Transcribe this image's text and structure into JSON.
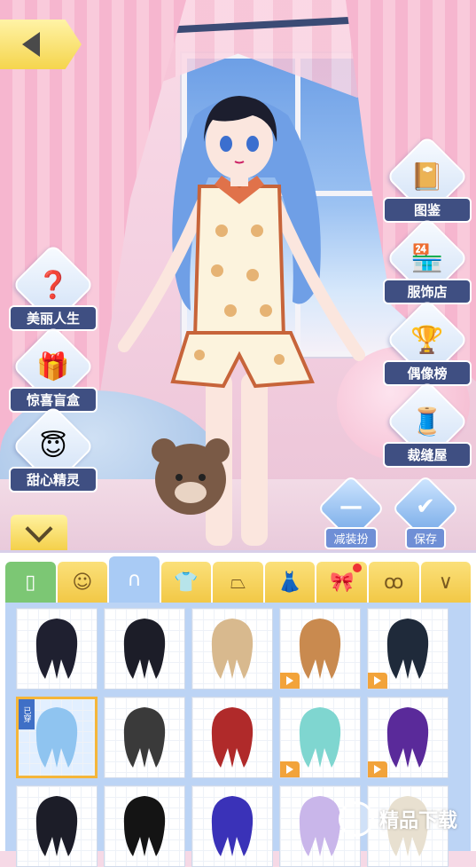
{
  "menu": {
    "encyclopedia_label": "图鉴",
    "clothing_store_label": "服饰店",
    "idol_rank_label": "偶像榜",
    "tailor_label": "裁缝屋",
    "beautiful_life_label": "美丽人生",
    "blind_box_label": "惊喜盲盒",
    "sweet_spirit_label": "甜心精灵"
  },
  "actions": {
    "undress_label": "减装扮",
    "save_label": "保存"
  },
  "tabs": [
    {
      "name": "wardrobe",
      "icon": "door-icon"
    },
    {
      "name": "face",
      "icon": "face-icon"
    },
    {
      "name": "hair",
      "icon": "hair-icon",
      "active": true
    },
    {
      "name": "top",
      "icon": "top-icon"
    },
    {
      "name": "skirt",
      "icon": "skirt-icon"
    },
    {
      "name": "dress",
      "icon": "dress-icon"
    },
    {
      "name": "headwear",
      "icon": "bow-icon",
      "badge": true
    },
    {
      "name": "earrings",
      "icon": "earring-icon"
    },
    {
      "name": "necklace",
      "icon": "necklace-icon"
    }
  ],
  "items": [
    {
      "color": "#1f2030",
      "video": false,
      "worn": false
    },
    {
      "color": "#1c1d28",
      "video": false,
      "worn": false
    },
    {
      "color": "#d8b98e",
      "video": false,
      "worn": false
    },
    {
      "color": "#c98a4f",
      "video": true,
      "worn": false
    },
    {
      "color": "#1f2a3a",
      "video": true,
      "worn": false
    },
    {
      "color": "#8fc4f0",
      "video": false,
      "worn": true
    },
    {
      "color": "#3a3a3a",
      "video": false,
      "worn": false
    },
    {
      "color": "#b02a2a",
      "video": false,
      "worn": false
    },
    {
      "color": "#7fd6d0",
      "video": true,
      "worn": false
    },
    {
      "color": "#5a2a9a",
      "video": true,
      "worn": false
    },
    {
      "color": "#1c1d28",
      "video": false,
      "worn": false
    },
    {
      "color": "#141414",
      "video": false,
      "worn": false
    },
    {
      "color": "#3a32b8",
      "video": false,
      "worn": false
    },
    {
      "color": "#c9b6ea",
      "video": false,
      "worn": false
    },
    {
      "color": "#e8e0d0",
      "video": false,
      "worn": false
    }
  ],
  "worn_label": "已穿",
  "watermark": "精品下载",
  "accent_color": "#3f4f82"
}
